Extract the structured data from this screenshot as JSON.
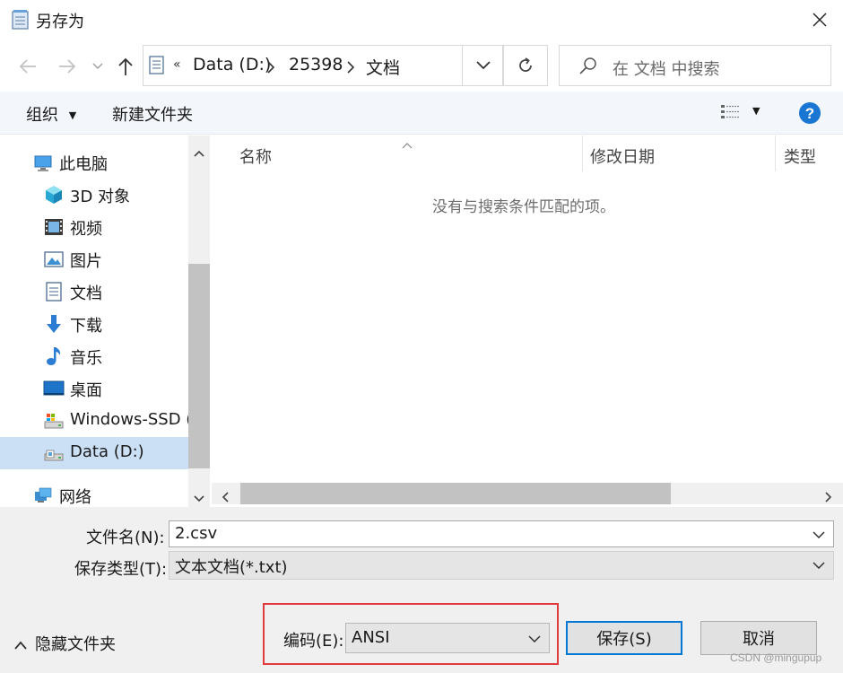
{
  "window": {
    "title": "另存为",
    "close_label": "✕"
  },
  "nav": {
    "back_icon": "arrow-left-icon",
    "forward_icon": "arrow-right-icon",
    "recent_icon": "chevron-down-icon",
    "up_icon": "arrow-up-icon",
    "breadcrumb_overflow": "«",
    "breadcrumb": [
      "Data (D:)",
      "25398",
      "文档"
    ],
    "search_placeholder": "在 文档 中搜索"
  },
  "toolbar": {
    "organize": "组织",
    "new_folder": "新建文件夹"
  },
  "sidebar": {
    "items": [
      {
        "label": "此电脑",
        "icon": "computer-icon",
        "root": true
      },
      {
        "label": "3D 对象",
        "icon": "cube-icon"
      },
      {
        "label": "视频",
        "icon": "video-icon"
      },
      {
        "label": "图片",
        "icon": "picture-icon"
      },
      {
        "label": "文档",
        "icon": "document-icon"
      },
      {
        "label": "下载",
        "icon": "download-icon"
      },
      {
        "label": "音乐",
        "icon": "music-icon"
      },
      {
        "label": "桌面",
        "icon": "desktop-icon"
      },
      {
        "label": "Windows-SSD (",
        "icon": "drive-icon"
      },
      {
        "label": "Data (D:)",
        "icon": "drive-icon",
        "selected": true
      },
      {
        "label": "网络",
        "icon": "network-icon",
        "root": true
      }
    ]
  },
  "file_list": {
    "columns": [
      "名称",
      "修改日期",
      "类型"
    ],
    "empty_message": "没有与搜索条件匹配的项。"
  },
  "form": {
    "filename_label": "文件名(N):",
    "filename_value": "2.csv",
    "filetype_label": "保存类型(T):",
    "filetype_value": "文本文档(*.txt)",
    "encoding_label": "编码(E):",
    "encoding_value": "ANSI",
    "save_label": "保存(S)",
    "cancel_label": "取消",
    "hide_folders_label": "隐藏文件夹"
  },
  "watermark": "CSDN @mingupup",
  "colors": {
    "accent": "#0078d7",
    "highlight_border": "#e0393e",
    "selected_bg": "#cce0f5",
    "help": "#1976d2"
  }
}
